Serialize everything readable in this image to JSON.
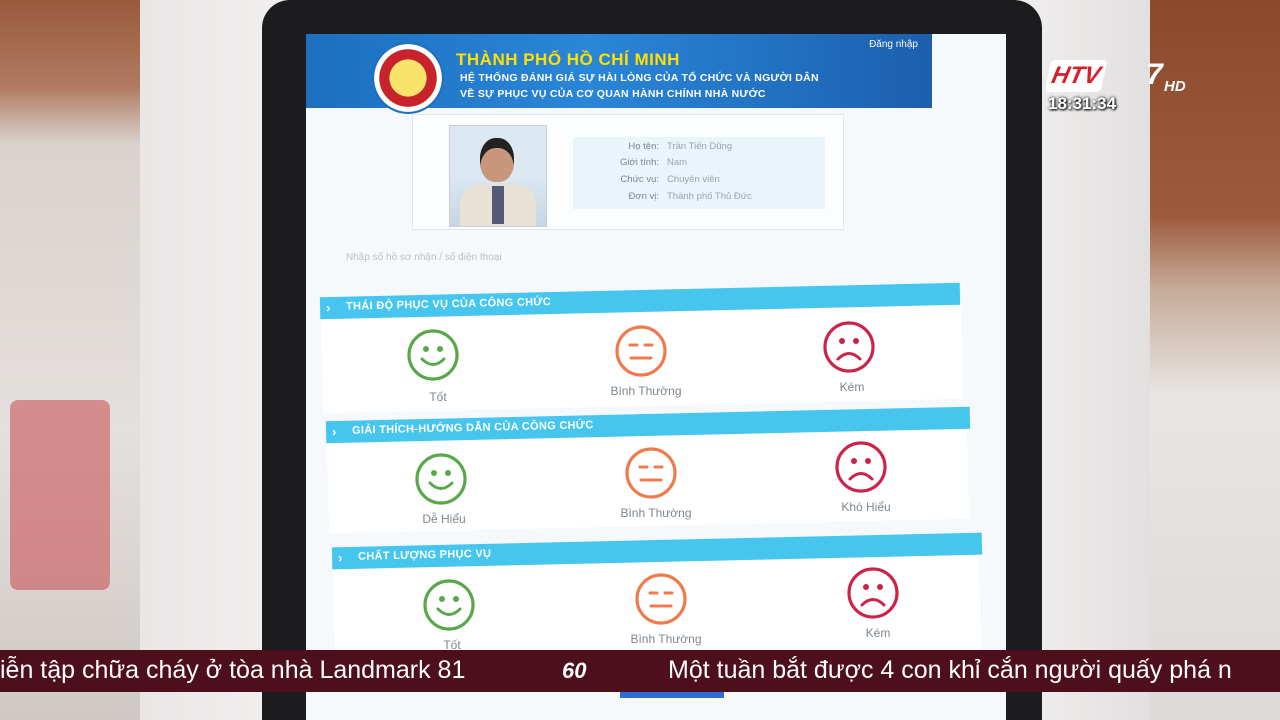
{
  "header": {
    "city_title": "THÀNH PHỐ HỒ CHÍ MINH",
    "subtitle_line1": "HỆ THỐNG ĐÁNH GIÁ SỰ HÀI LÒNG CỦA TỔ CHỨC VÀ NGƯỜI DÂN",
    "subtitle_line2": "VỀ SỰ PHỤC VỤ CỦA CƠ QUAN HÀNH CHÍNH NHÀ NƯỚC",
    "login_label": "Đăng nhập"
  },
  "profile": {
    "rows": [
      {
        "label": "Họ tên:",
        "value": "Trần Tiến Dũng"
      },
      {
        "label": "Giới tính:",
        "value": "Nam"
      },
      {
        "label": "Chức vụ:",
        "value": "Chuyên viên"
      },
      {
        "label": "Đơn vị:",
        "value": "Thành phố Thủ Đức"
      }
    ]
  },
  "hint_text": "Nhập số hồ sơ nhận / số điện thoại",
  "sections": [
    {
      "title": "THÁI ĐỘ PHỤC VỤ CỦA CÔNG CHỨC",
      "options": [
        {
          "label": "Tốt",
          "mood": "good"
        },
        {
          "label": "Bình Thường",
          "mood": "neutral"
        },
        {
          "label": "Kém",
          "mood": "bad"
        }
      ]
    },
    {
      "title": "GIẢI THÍCH-HƯỚNG DẪN CỦA CÔNG CHỨC",
      "options": [
        {
          "label": "Dễ Hiểu",
          "mood": "good"
        },
        {
          "label": "Bình Thường",
          "mood": "neutral"
        },
        {
          "label": "Khó Hiểu",
          "mood": "bad"
        }
      ]
    },
    {
      "title": "CHẤT LƯỢNG PHỤC VỤ",
      "options": [
        {
          "label": "Tốt",
          "mood": "good"
        },
        {
          "label": "Bình Thường",
          "mood": "neutral"
        },
        {
          "label": "Kém",
          "mood": "bad"
        }
      ]
    }
  ],
  "colors": {
    "good": "#58a84a",
    "neutral": "#ee7a4e",
    "bad": "#cc2448",
    "section_bar": "#46c6ee"
  },
  "broadcast": {
    "channel_logo": "HTV",
    "channel_number": "7",
    "channel_hd": "HD",
    "clock": "18:31:34",
    "ticker_left": "iễn tập chữa cháy ở tòa nhà Landmark 81",
    "ticker_logo": "60",
    "ticker_right": "Một tuần bắt được 4 con khỉ cắn người quấy phá n"
  }
}
